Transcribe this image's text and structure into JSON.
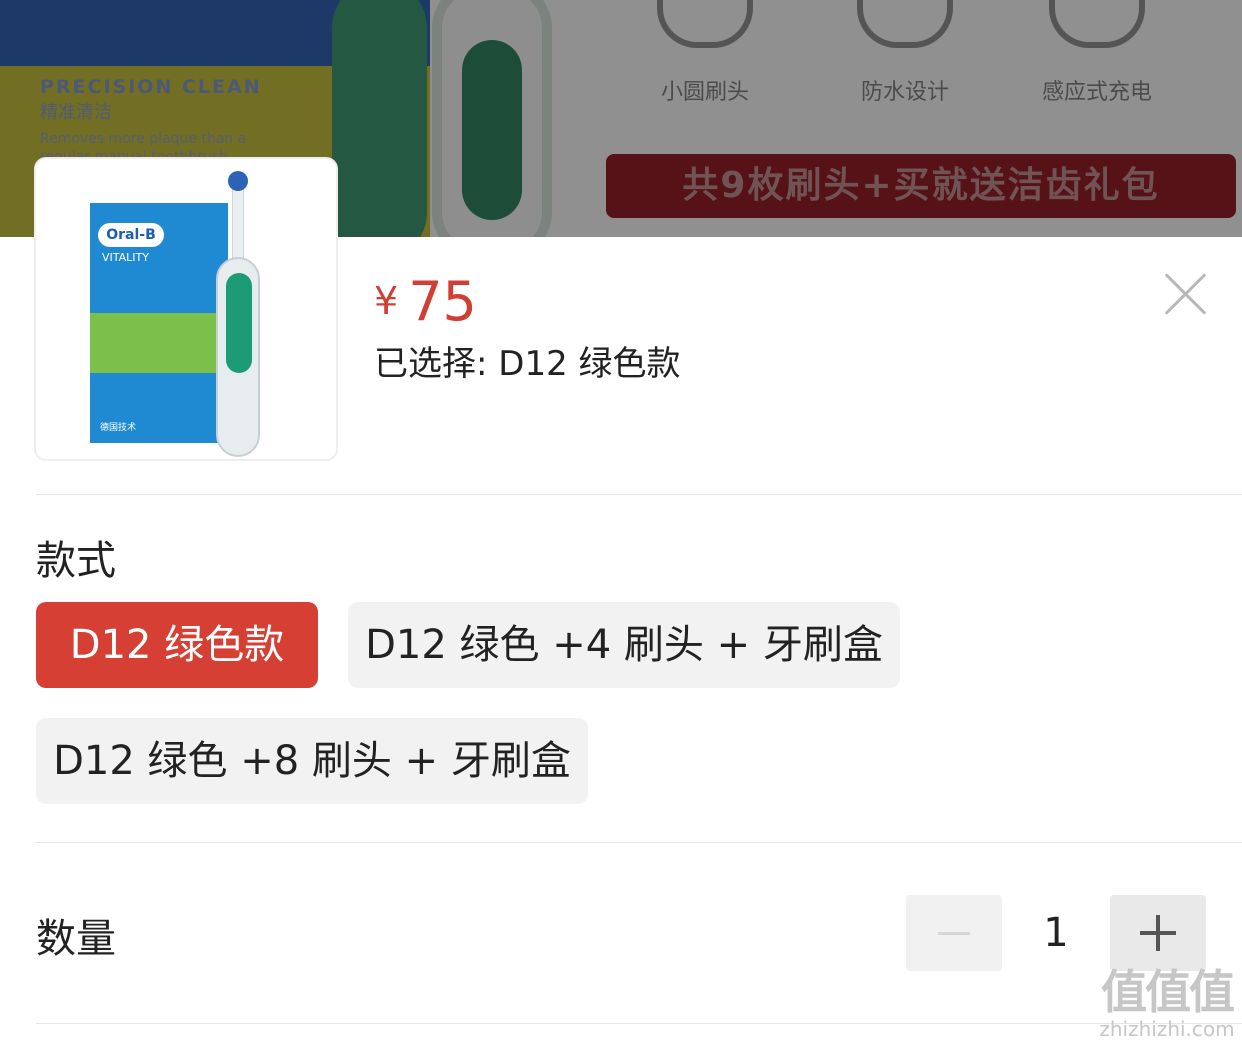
{
  "background": {
    "banner_en": "PRECISION CLEAN",
    "banner_cn": "精准清洁",
    "banner_sub": "Removes more plaque than a regular manual toothbrush",
    "features": [
      "小圆刷头",
      "防水设计",
      "感应式充电"
    ],
    "promo": "共9枚刷头+买就送洁齿礼包"
  },
  "product": {
    "thumbnail": {
      "brand": "Oral-B",
      "model": "VITALITY",
      "caption": "德国技术"
    },
    "price_symbol": "¥",
    "price_value": "75",
    "selected_text": "已选择: D12 绿色款",
    "accent_color": "#d63f33"
  },
  "style_section": {
    "title": "款式",
    "options": [
      {
        "label": "D12 绿色款",
        "selected": true
      },
      {
        "label": "D12 绿色 +4 刷头 + 牙刷盒",
        "selected": false
      },
      {
        "label": "D12 绿色 +8 刷头 + 牙刷盒",
        "selected": false
      }
    ]
  },
  "quantity_section": {
    "title": "数量",
    "value": "1"
  },
  "watermark": {
    "logo": "值值值",
    "url": "zhizhizhi.com"
  }
}
